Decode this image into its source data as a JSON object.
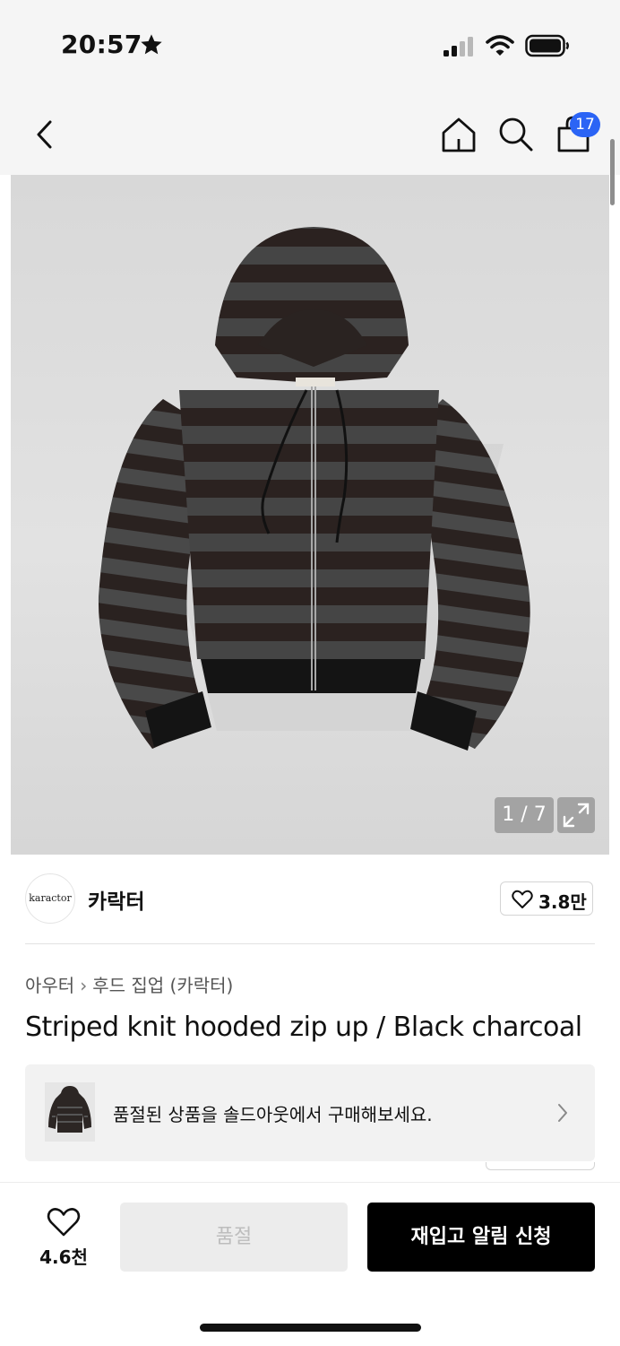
{
  "status_bar": {
    "time": "20:57"
  },
  "nav": {
    "cart_count": "17"
  },
  "gallery": {
    "counter": "1 / 7"
  },
  "brand": {
    "logo_text": "karactor",
    "name": "카락터",
    "like_count": "3.8만"
  },
  "breadcrumb": {
    "category": "아우터",
    "subcategory": "후드 집업 (카락터)"
  },
  "product": {
    "title": "Striped knit hooded zip up / Black charcoal"
  },
  "soldout_banner": {
    "text": "품절된 상품을 솔드아웃에서 구매해보세요."
  },
  "bottom_bar": {
    "like_count": "4.6천",
    "soldout_label": "품절",
    "restock_label": "재입고 알림 신청"
  },
  "icons": {
    "back": "chevron-left-icon",
    "home": "home-icon",
    "search": "search-icon",
    "cart": "shopping-bag-icon",
    "expand": "expand-icon",
    "heart": "heart-icon",
    "chevron": "chevron-right-icon"
  },
  "colors": {
    "badge": "#2b64f5",
    "primary_button": "#000000",
    "disabled_button": "#ececec"
  }
}
